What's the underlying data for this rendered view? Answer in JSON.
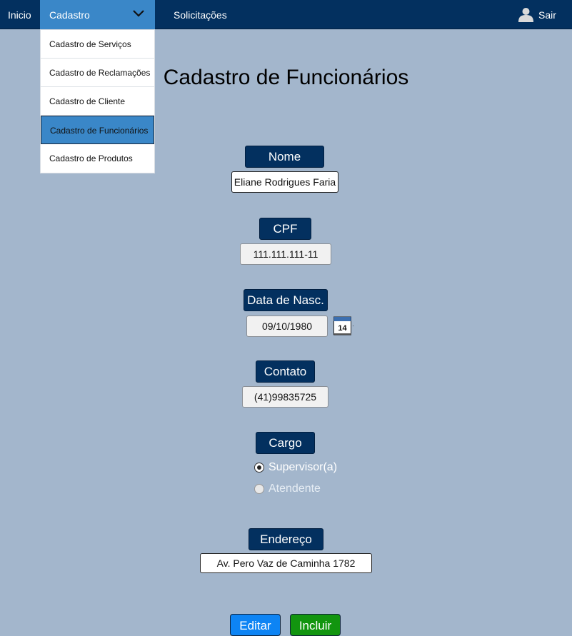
{
  "nav": {
    "inicio": "Inicio",
    "cadastro": "Cadastro",
    "solicitacoes": "Solicitações",
    "sair": "Sair"
  },
  "dropdown": {
    "items": [
      {
        "label": "Cadastro de Serviços"
      },
      {
        "label": "Cadastro de Reclamações"
      },
      {
        "label": "Cadastro de Cliente"
      },
      {
        "label": "Cadastro de Funcionários",
        "active": true
      },
      {
        "label": "Cadastro de Produtos"
      }
    ]
  },
  "page": {
    "title": "Cadastro de Funcionários"
  },
  "form": {
    "nome": {
      "label": "Nome",
      "value": "Eliane Rodrigues Faria"
    },
    "cpf": {
      "label": "CPF",
      "value": "111.111.111-11"
    },
    "nascimento": {
      "label": "Data de Nasc.",
      "value": "09/10/1980",
      "calendar_day": "14"
    },
    "contato": {
      "label": "Contato",
      "value": "(41)99835725"
    },
    "cargo": {
      "label": "Cargo",
      "options": [
        {
          "label": "Supervisor(a)",
          "checked": true
        },
        {
          "label": "Atendente",
          "checked": false
        }
      ]
    },
    "endereco": {
      "label": "Endereço",
      "value": "Av. Pero Vaz de Caminha 1782"
    }
  },
  "buttons": {
    "editar": "Editar",
    "incluir": "Incluir"
  },
  "colors": {
    "navbar": "#03305f",
    "accent": "#3a87c8",
    "background": "#a3b6cc",
    "editar": "#0d84f4",
    "incluir": "#12950f"
  }
}
